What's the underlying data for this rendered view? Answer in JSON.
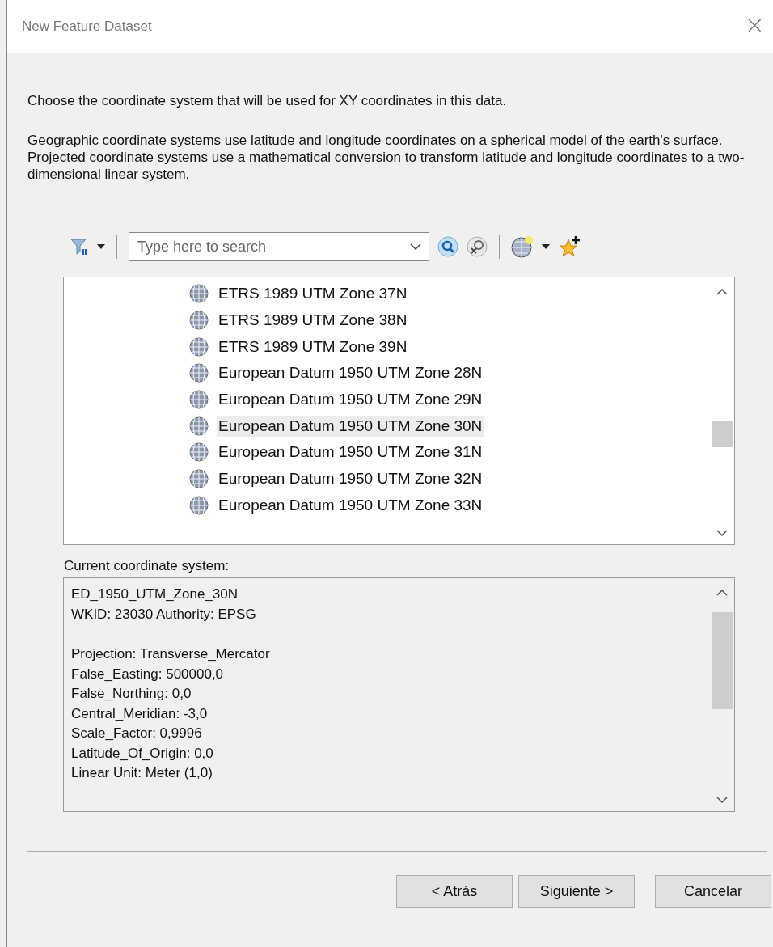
{
  "window": {
    "title": "New Feature Dataset",
    "close": "×"
  },
  "intro": "Choose the coordinate system that will be used for XY coordinates in this data.",
  "description": "Geographic coordinate systems use latitude and longitude coordinates on a spherical model of the earth's surface. Projected coordinate systems use a mathematical conversion to transform latitude and longitude coordinates to a two-dimensional linear system.",
  "search": {
    "placeholder": "Type here to search"
  },
  "list": [
    {
      "label": "ETRS 1989 UTM Zone 37N",
      "selected": false
    },
    {
      "label": "ETRS 1989 UTM Zone 38N",
      "selected": false
    },
    {
      "label": "ETRS 1989 UTM Zone 39N",
      "selected": false
    },
    {
      "label": "European Datum 1950 UTM Zone 28N",
      "selected": false
    },
    {
      "label": "European Datum 1950 UTM Zone 29N",
      "selected": false
    },
    {
      "label": "European Datum 1950 UTM Zone 30N",
      "selected": true
    },
    {
      "label": "European Datum 1950 UTM Zone 31N",
      "selected": false
    },
    {
      "label": "European Datum 1950 UTM Zone 32N",
      "selected": false
    },
    {
      "label": "European Datum 1950 UTM Zone 33N",
      "selected": false
    }
  ],
  "current_label": "Current coordinate system:",
  "current_blocks": [
    [
      "ED_1950_UTM_Zone_30N",
      "WKID: 23030 Authority: EPSG"
    ],
    [
      "Projection: Transverse_Mercator",
      "False_Easting: 500000,0",
      "False_Northing: 0,0",
      "Central_Meridian: -3,0",
      "Scale_Factor: 0,9996",
      "Latitude_Of_Origin: 0,0",
      "Linear Unit: Meter (1,0)"
    ]
  ],
  "buttons": [
    "< Atrás",
    "Siguiente >",
    "Cancelar"
  ]
}
